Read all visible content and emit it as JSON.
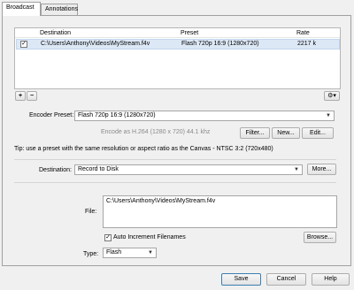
{
  "tabs": [
    {
      "label": "Broadcast"
    },
    {
      "label": "Annotations"
    }
  ],
  "list": {
    "columns": [
      "Destination",
      "Preset",
      "Rate"
    ],
    "rows": [
      {
        "checked": true,
        "destination": "C:\\Users\\Anthony\\Videos\\MyStream.f4v",
        "preset": "Flash 720p 16:9 (1280x720)",
        "rate": "2217 k"
      }
    ],
    "add_label": "+",
    "remove_label": "−",
    "gear_label": "⚙▾"
  },
  "encoder": {
    "label": "Encoder Preset:",
    "value": "Flash 720p 16:9 (1280x720)",
    "info": "Encode as H.264 (1280 x 720) 44.1 khz",
    "filter_label": "Filter...",
    "new_label": "New...",
    "edit_label": "Edit..."
  },
  "tip": "Tip: use a preset with the same resolution or aspect ratio as the Canvas - NTSC 3:2 (720x480)",
  "destination": {
    "label": "Destination:",
    "value": "Record to Disk",
    "more_label": "More..."
  },
  "file": {
    "label": "File:",
    "value": "C:\\Users\\Anthony\\Videos\\MyStream.f4v",
    "auto_increment_label": "Auto Increment Filenames",
    "auto_increment_checked": true,
    "browse_label": "Browse..."
  },
  "type": {
    "label": "Type:",
    "value": "Flash"
  },
  "footer": {
    "save_label": "Save",
    "cancel_label": "Cancel",
    "help_label": "Help"
  }
}
